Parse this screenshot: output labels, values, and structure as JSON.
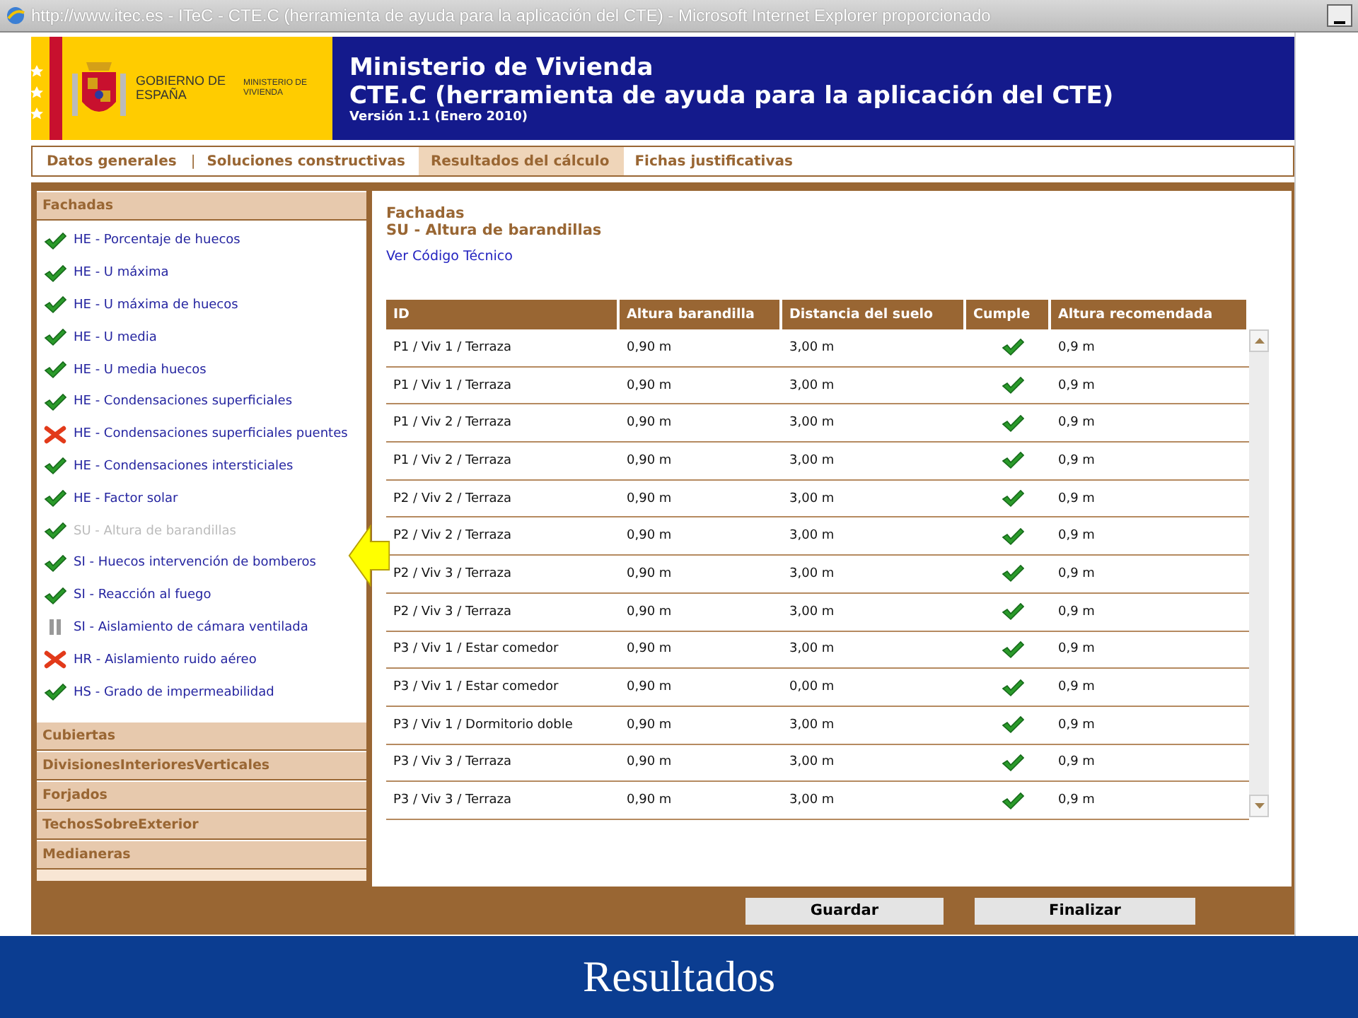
{
  "window": {
    "title": "http://www.itec.es - ITeC - CTE.C (herramienta de ayuda para la aplicación del CTE) - Microsoft Internet Explorer proporcionado"
  },
  "header": {
    "government": "GOBIERNO DE ESPAÑA",
    "ministry_logo": "MINISTERIO DE VIVIENDA",
    "ministry": "Ministerio de Vivienda",
    "app_title": "CTE.C (herramienta de ayuda para la aplicación del CTE)",
    "version": "Versión 1.1 (Enero 2010)"
  },
  "tab_separator": "|",
  "tabs": [
    {
      "label": "Datos generales",
      "selected": false
    },
    {
      "label": "Soluciones constructivas",
      "selected": false
    },
    {
      "label": "Resultados del cálculo",
      "selected": true
    },
    {
      "label": "Fichas justificativas",
      "selected": false
    }
  ],
  "sidebar": {
    "sections": [
      {
        "title": "Fachadas",
        "items": [
          {
            "label": "HE - Porcentaje de huecos",
            "kind": "pass",
            "disabled": false
          },
          {
            "label": "HE - U máxima",
            "kind": "pass",
            "disabled": false
          },
          {
            "label": "HE - U máxima de huecos",
            "kind": "pass",
            "disabled": false
          },
          {
            "label": "HE - U media",
            "kind": "pass",
            "disabled": false
          },
          {
            "label": "HE - U media huecos",
            "kind": "pass",
            "disabled": false
          },
          {
            "label": "HE - Condensaciones superficiales",
            "kind": "pass",
            "disabled": false
          },
          {
            "label": "HE - Condensaciones superficiales puentes",
            "kind": "fail",
            "disabled": false
          },
          {
            "label": "HE - Condensaciones intersticiales",
            "kind": "pass",
            "disabled": false
          },
          {
            "label": "HE - Factor solar",
            "kind": "pass",
            "disabled": false
          },
          {
            "label": "SU - Altura de barandillas",
            "kind": "pass",
            "disabled": true
          },
          {
            "label": "SI - Huecos intervención de bomberos",
            "kind": "pass",
            "disabled": false
          },
          {
            "label": "SI - Reacción al fuego",
            "kind": "pass",
            "disabled": false
          },
          {
            "label": "SI - Aislamiento de cámara ventilada",
            "kind": "pending",
            "disabled": false
          },
          {
            "label": "HR - Aislamiento ruido aéreo",
            "kind": "fail",
            "disabled": false
          },
          {
            "label": "HS - Grado de impermeabilidad",
            "kind": "pass",
            "disabled": false
          }
        ]
      },
      {
        "title": "Cubiertas"
      },
      {
        "title": "DivisionesInterioresVerticales"
      },
      {
        "title": "Forjados"
      },
      {
        "title": "TechosSobreExterior"
      },
      {
        "title": "Medianeras"
      }
    ]
  },
  "content": {
    "section": "Fachadas",
    "heading": "SU - Altura de barandillas",
    "link": "Ver Código Técnico"
  },
  "table": {
    "columns": [
      "ID",
      "Altura barandilla",
      "Distancia del suelo",
      "Cumple",
      "Altura recomendada"
    ],
    "rows": [
      {
        "id": "P1 / Viv 1 / Terraza",
        "height": "0,90 m",
        "distance": "3,00 m",
        "complies": true,
        "recommended": "0,9 m"
      },
      {
        "id": "P1 / Viv 1 / Terraza",
        "height": "0,90 m",
        "distance": "3,00 m",
        "complies": true,
        "recommended": "0,9 m"
      },
      {
        "id": "P1 / Viv 2 / Terraza",
        "height": "0,90 m",
        "distance": "3,00 m",
        "complies": true,
        "recommended": "0,9 m"
      },
      {
        "id": "P1 / Viv 2 / Terraza",
        "height": "0,90 m",
        "distance": "3,00 m",
        "complies": true,
        "recommended": "0,9 m"
      },
      {
        "id": "P2 / Viv 2 / Terraza",
        "height": "0,90 m",
        "distance": "3,00 m",
        "complies": true,
        "recommended": "0,9 m"
      },
      {
        "id": "P2 / Viv 2 / Terraza",
        "height": "0,90 m",
        "distance": "3,00 m",
        "complies": true,
        "recommended": "0,9 m"
      },
      {
        "id": "P2 / Viv 3 / Terraza",
        "height": "0,90 m",
        "distance": "3,00 m",
        "complies": true,
        "recommended": "0,9 m"
      },
      {
        "id": "P2 / Viv 3 / Terraza",
        "height": "0,90 m",
        "distance": "3,00 m",
        "complies": true,
        "recommended": "0,9 m"
      },
      {
        "id": "P3 / Viv 1 / Estar comedor",
        "height": "0,90 m",
        "distance": "3,00 m",
        "complies": true,
        "recommended": "0,9 m"
      },
      {
        "id": "P3 / Viv 1 / Estar comedor",
        "height": "0,90 m",
        "distance": "0,00 m",
        "complies": true,
        "recommended": "0,9 m"
      },
      {
        "id": "P3 / Viv 1 / Dormitorio doble",
        "height": "0,90 m",
        "distance": "3,00 m",
        "complies": true,
        "recommended": "0,9 m"
      },
      {
        "id": "P3 / Viv 3 / Terraza",
        "height": "0,90 m",
        "distance": "3,00 m",
        "complies": true,
        "recommended": "0,9 m"
      },
      {
        "id": "P3 / Viv 3 / Terraza",
        "height": "0,90 m",
        "distance": "3,00 m",
        "complies": true,
        "recommended": "0,9 m"
      }
    ]
  },
  "buttons": [
    "Guardar",
    "Finalizar"
  ],
  "caption": "Resultados"
}
